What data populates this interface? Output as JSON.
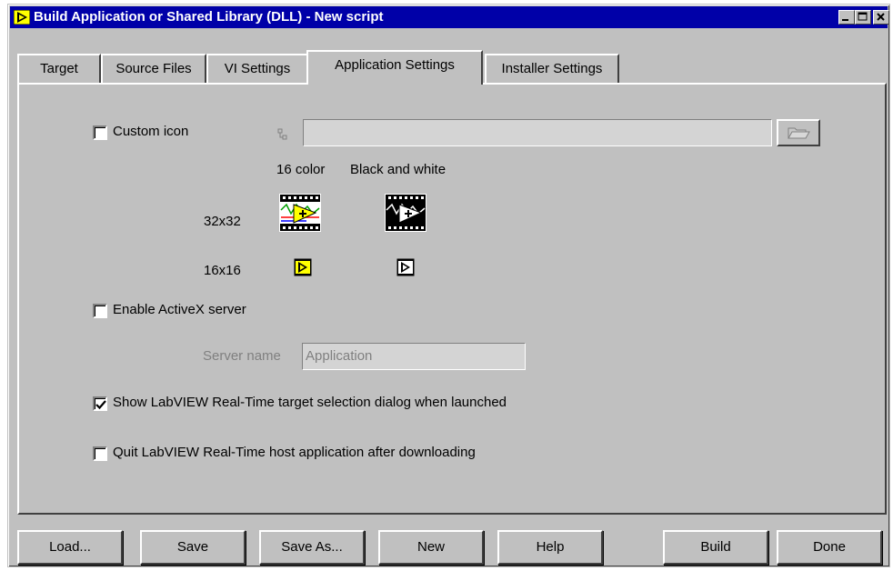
{
  "window": {
    "title": "Build Application or Shared Library (DLL) - New script",
    "controls": [
      "minimize-icon",
      "maximize-icon",
      "close-icon"
    ]
  },
  "tabs": [
    {
      "label": "Target"
    },
    {
      "label": "Source Files"
    },
    {
      "label": "VI Settings"
    },
    {
      "label": "Application Settings",
      "active": true
    },
    {
      "label": "Installer Settings"
    }
  ],
  "app_settings": {
    "custom_icon": {
      "label": "Custom icon",
      "checked": false,
      "path_value": ""
    },
    "icon_columns": {
      "color": "16 color",
      "bw": "Black and white"
    },
    "icon_rows": {
      "large": "32x32",
      "small": "16x16"
    },
    "activex": {
      "label": "Enable ActiveX server",
      "checked": false
    },
    "server_name": {
      "label": "Server name",
      "value": "Application"
    },
    "show_dialog": {
      "label": "Show LabVIEW Real-Time target selection dialog when launched",
      "checked": true
    },
    "quit_host": {
      "label": "Quit LabVIEW Real-Time host application after downloading",
      "checked": false
    }
  },
  "buttons": {
    "load": "Load...",
    "save": "Save",
    "save_as": "Save As...",
    "new": "New",
    "help": "Help",
    "build": "Build",
    "done": "Done"
  },
  "colors": {
    "titlebar": "#0000a8",
    "face": "#c0c0c0",
    "icon_yellow": "#ffff00"
  }
}
